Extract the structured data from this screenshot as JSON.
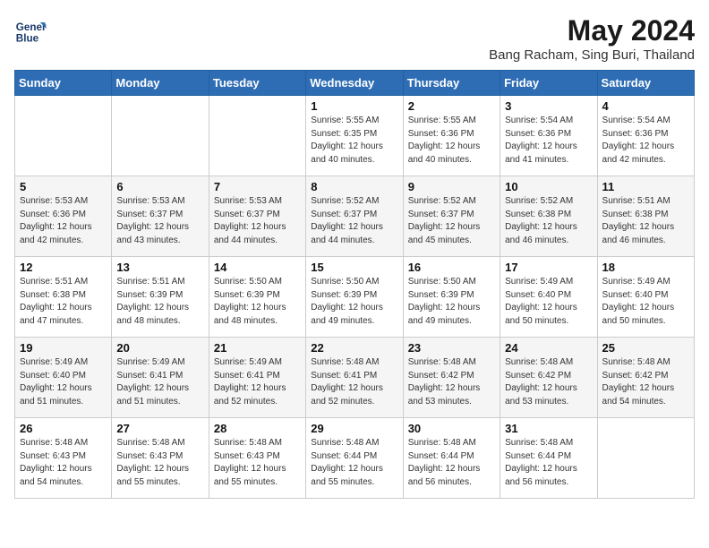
{
  "header": {
    "logo_line1": "General",
    "logo_line2": "Blue",
    "title": "May 2024",
    "subtitle": "Bang Racham, Sing Buri, Thailand"
  },
  "weekdays": [
    "Sunday",
    "Monday",
    "Tuesday",
    "Wednesday",
    "Thursday",
    "Friday",
    "Saturday"
  ],
  "weeks": [
    [
      {
        "day": "",
        "info": ""
      },
      {
        "day": "",
        "info": ""
      },
      {
        "day": "",
        "info": ""
      },
      {
        "day": "1",
        "info": "Sunrise: 5:55 AM\nSunset: 6:35 PM\nDaylight: 12 hours\nand 40 minutes."
      },
      {
        "day": "2",
        "info": "Sunrise: 5:55 AM\nSunset: 6:36 PM\nDaylight: 12 hours\nand 40 minutes."
      },
      {
        "day": "3",
        "info": "Sunrise: 5:54 AM\nSunset: 6:36 PM\nDaylight: 12 hours\nand 41 minutes."
      },
      {
        "day": "4",
        "info": "Sunrise: 5:54 AM\nSunset: 6:36 PM\nDaylight: 12 hours\nand 42 minutes."
      }
    ],
    [
      {
        "day": "5",
        "info": "Sunrise: 5:53 AM\nSunset: 6:36 PM\nDaylight: 12 hours\nand 42 minutes."
      },
      {
        "day": "6",
        "info": "Sunrise: 5:53 AM\nSunset: 6:37 PM\nDaylight: 12 hours\nand 43 minutes."
      },
      {
        "day": "7",
        "info": "Sunrise: 5:53 AM\nSunset: 6:37 PM\nDaylight: 12 hours\nand 44 minutes."
      },
      {
        "day": "8",
        "info": "Sunrise: 5:52 AM\nSunset: 6:37 PM\nDaylight: 12 hours\nand 44 minutes."
      },
      {
        "day": "9",
        "info": "Sunrise: 5:52 AM\nSunset: 6:37 PM\nDaylight: 12 hours\nand 45 minutes."
      },
      {
        "day": "10",
        "info": "Sunrise: 5:52 AM\nSunset: 6:38 PM\nDaylight: 12 hours\nand 46 minutes."
      },
      {
        "day": "11",
        "info": "Sunrise: 5:51 AM\nSunset: 6:38 PM\nDaylight: 12 hours\nand 46 minutes."
      }
    ],
    [
      {
        "day": "12",
        "info": "Sunrise: 5:51 AM\nSunset: 6:38 PM\nDaylight: 12 hours\nand 47 minutes."
      },
      {
        "day": "13",
        "info": "Sunrise: 5:51 AM\nSunset: 6:39 PM\nDaylight: 12 hours\nand 48 minutes."
      },
      {
        "day": "14",
        "info": "Sunrise: 5:50 AM\nSunset: 6:39 PM\nDaylight: 12 hours\nand 48 minutes."
      },
      {
        "day": "15",
        "info": "Sunrise: 5:50 AM\nSunset: 6:39 PM\nDaylight: 12 hours\nand 49 minutes."
      },
      {
        "day": "16",
        "info": "Sunrise: 5:50 AM\nSunset: 6:39 PM\nDaylight: 12 hours\nand 49 minutes."
      },
      {
        "day": "17",
        "info": "Sunrise: 5:49 AM\nSunset: 6:40 PM\nDaylight: 12 hours\nand 50 minutes."
      },
      {
        "day": "18",
        "info": "Sunrise: 5:49 AM\nSunset: 6:40 PM\nDaylight: 12 hours\nand 50 minutes."
      }
    ],
    [
      {
        "day": "19",
        "info": "Sunrise: 5:49 AM\nSunset: 6:40 PM\nDaylight: 12 hours\nand 51 minutes."
      },
      {
        "day": "20",
        "info": "Sunrise: 5:49 AM\nSunset: 6:41 PM\nDaylight: 12 hours\nand 51 minutes."
      },
      {
        "day": "21",
        "info": "Sunrise: 5:49 AM\nSunset: 6:41 PM\nDaylight: 12 hours\nand 52 minutes."
      },
      {
        "day": "22",
        "info": "Sunrise: 5:48 AM\nSunset: 6:41 PM\nDaylight: 12 hours\nand 52 minutes."
      },
      {
        "day": "23",
        "info": "Sunrise: 5:48 AM\nSunset: 6:42 PM\nDaylight: 12 hours\nand 53 minutes."
      },
      {
        "day": "24",
        "info": "Sunrise: 5:48 AM\nSunset: 6:42 PM\nDaylight: 12 hours\nand 53 minutes."
      },
      {
        "day": "25",
        "info": "Sunrise: 5:48 AM\nSunset: 6:42 PM\nDaylight: 12 hours\nand 54 minutes."
      }
    ],
    [
      {
        "day": "26",
        "info": "Sunrise: 5:48 AM\nSunset: 6:43 PM\nDaylight: 12 hours\nand 54 minutes."
      },
      {
        "day": "27",
        "info": "Sunrise: 5:48 AM\nSunset: 6:43 PM\nDaylight: 12 hours\nand 55 minutes."
      },
      {
        "day": "28",
        "info": "Sunrise: 5:48 AM\nSunset: 6:43 PM\nDaylight: 12 hours\nand 55 minutes."
      },
      {
        "day": "29",
        "info": "Sunrise: 5:48 AM\nSunset: 6:44 PM\nDaylight: 12 hours\nand 55 minutes."
      },
      {
        "day": "30",
        "info": "Sunrise: 5:48 AM\nSunset: 6:44 PM\nDaylight: 12 hours\nand 56 minutes."
      },
      {
        "day": "31",
        "info": "Sunrise: 5:48 AM\nSunset: 6:44 PM\nDaylight: 12 hours\nand 56 minutes."
      },
      {
        "day": "",
        "info": ""
      }
    ]
  ]
}
